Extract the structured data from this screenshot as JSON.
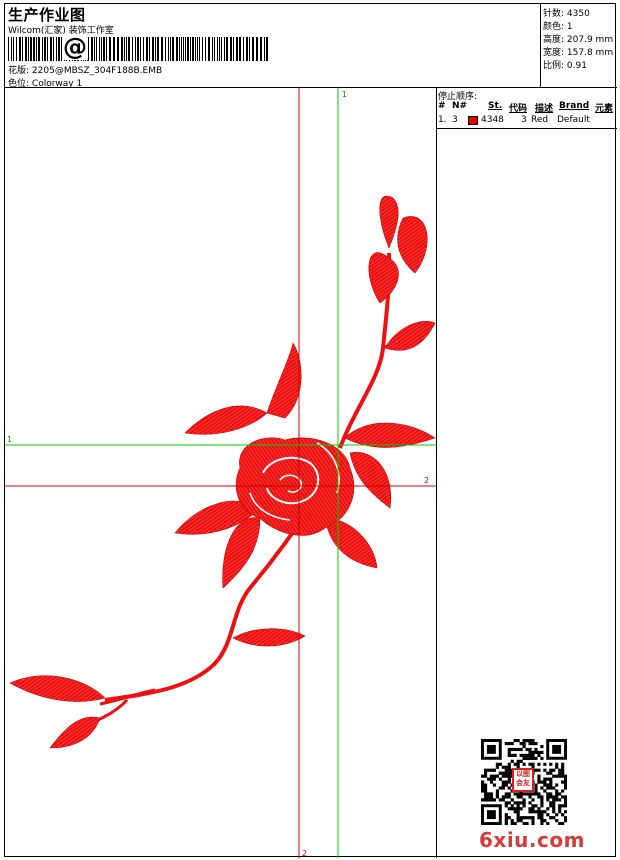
{
  "header": {
    "title": "生产作业图",
    "studio": "Wilcom(汇家) 装饰工作室",
    "barcode_symbol": "@",
    "design_label": "花版:",
    "design_value": "2205@MBSZ_304F188B.EMB",
    "colorway_label": "色位:",
    "colorway_value": "Colorway 1"
  },
  "stats": {
    "stitches_label": "针数:",
    "stitches_value": "4350",
    "colors_label": "颜色:",
    "colors_value": "1",
    "height_label": "高度:",
    "height_value": "207.9 mm",
    "width_label": "宽度:",
    "width_value": "157.8 mm",
    "ratio_label": "比例:",
    "ratio_value": "0.91"
  },
  "stop_sequence": {
    "title": "停止顺序:",
    "columns": {
      "hash": "#",
      "no": "N#",
      "st": "St.",
      "code": "代码",
      "desc": "描述",
      "brand": "Brand",
      "element": "元素"
    },
    "rows": [
      {
        "index": "1.",
        "needle": "3",
        "stitches": "4348",
        "code": "3",
        "desc": "Red",
        "brand": "Default",
        "color": "#e00000"
      }
    ]
  },
  "guides": {
    "green_top": "1",
    "green_left": "1",
    "red_right": "2",
    "red_bottom": "2"
  },
  "colors": {
    "embroidery": "#ee1010",
    "guide_red": "#d40000",
    "guide_green": "#00cc00"
  },
  "watermark": {
    "text": "6xiu.com",
    "stamp_text": "以图会友"
  }
}
